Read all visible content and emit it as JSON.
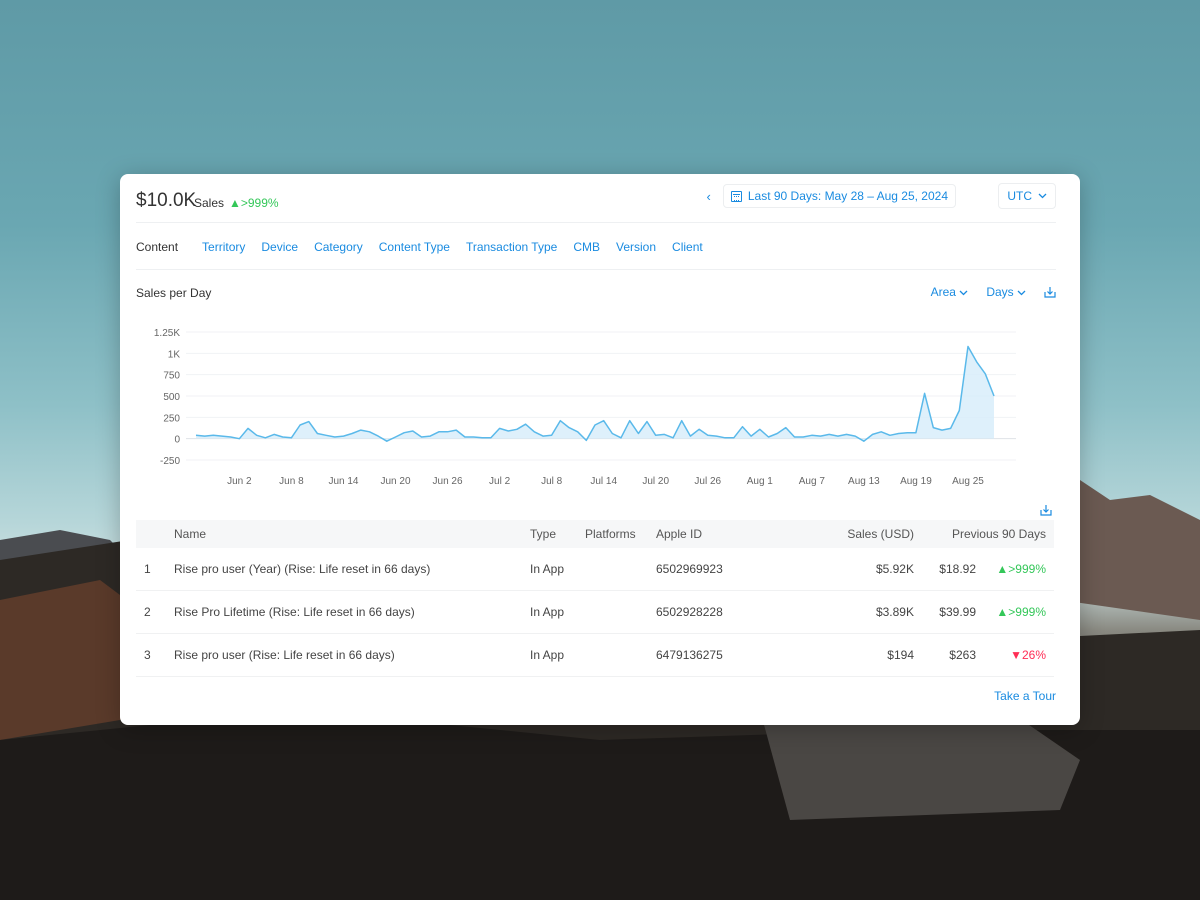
{
  "header": {
    "total": "$10.0K",
    "total_label": "Sales",
    "total_change": "▲>999%",
    "date_range": "Last 90 Days: May 28 – Aug 25, 2024",
    "timezone": "UTC"
  },
  "tabs": [
    {
      "label": "Content",
      "active": true
    },
    {
      "label": "Territory"
    },
    {
      "label": "Device"
    },
    {
      "label": "Category"
    },
    {
      "label": "Content Type"
    },
    {
      "label": "Transaction Type"
    },
    {
      "label": "CMB"
    },
    {
      "label": "Version"
    },
    {
      "label": "Client"
    }
  ],
  "chart_section": {
    "title": "Sales per Day",
    "type_selector": "Area",
    "interval_selector": "Days"
  },
  "chart_data": {
    "type": "area",
    "y_ticks": [
      "1.25K",
      "1K",
      "750",
      "500",
      "250",
      "0",
      "-250"
    ],
    "ylim": [
      -250,
      1250
    ],
    "x_ticks": [
      "Jun 2",
      "Jun 8",
      "Jun 14",
      "Jun 20",
      "Jun 26",
      "Jul 2",
      "Jul 8",
      "Jul 14",
      "Jul 20",
      "Jul 26",
      "Aug 1",
      "Aug 7",
      "Aug 13",
      "Aug 19",
      "Aug 25"
    ],
    "x_start": "May 28",
    "x_end": "Aug 25",
    "values": [
      40,
      30,
      40,
      30,
      20,
      0,
      120,
      40,
      10,
      50,
      20,
      10,
      160,
      200,
      60,
      40,
      20,
      30,
      60,
      100,
      80,
      30,
      -30,
      20,
      70,
      90,
      20,
      30,
      80,
      80,
      100,
      20,
      20,
      10,
      10,
      120,
      90,
      110,
      170,
      80,
      30,
      40,
      210,
      130,
      80,
      -20,
      160,
      210,
      60,
      10,
      210,
      60,
      200,
      40,
      50,
      10,
      210,
      30,
      110,
      40,
      30,
      10,
      10,
      140,
      30,
      110,
      20,
      60,
      130,
      20,
      20,
      40,
      30,
      50,
      30,
      50,
      30,
      -30,
      50,
      80,
      40,
      60,
      70,
      70,
      530,
      130,
      100,
      120,
      330,
      1080,
      900,
      760,
      500
    ],
    "color": "#5ab9ea",
    "fill": "#d6ecfa"
  },
  "table": {
    "headers": {
      "name": "Name",
      "type": "Type",
      "platforms": "Platforms",
      "apple_id": "Apple ID",
      "sales": "Sales (USD)",
      "previous": "Previous 90 Days"
    },
    "rows": [
      {
        "idx": "1",
        "name": "Rise pro user (Year) (Rise: Life reset in 66 days)",
        "type": "In App",
        "platforms": "",
        "apple_id": "6502969923",
        "sales": "$5.92K",
        "previous": "$18.92",
        "change": "▲>999%",
        "direction": "up"
      },
      {
        "idx": "2",
        "name": "Rise Pro Lifetime (Rise: Life reset in 66 days)",
        "type": "In App",
        "platforms": "",
        "apple_id": "6502928228",
        "sales": "$3.89K",
        "previous": "$39.99",
        "change": "▲>999%",
        "direction": "up"
      },
      {
        "idx": "3",
        "name": "Rise pro user (Rise: Life reset in 66 days)",
        "type": "In App",
        "platforms": "",
        "apple_id": "6479136275",
        "sales": "$194",
        "previous": "$263",
        "change": "▼26%",
        "direction": "down"
      }
    ]
  },
  "footer": {
    "tour": "Take a Tour"
  },
  "colors": {
    "accent": "#1a8be0",
    "positive": "#34c759",
    "negative": "#ff2d55"
  }
}
